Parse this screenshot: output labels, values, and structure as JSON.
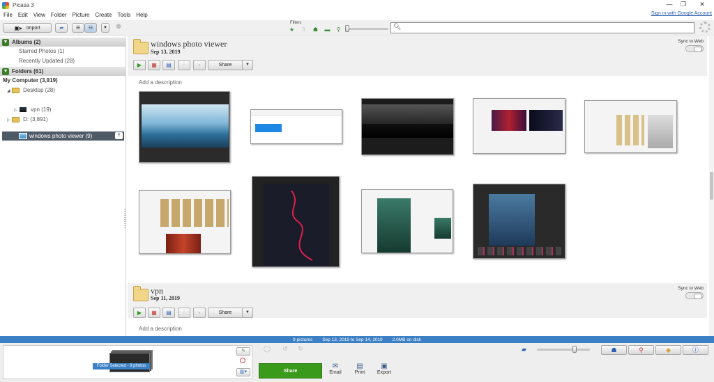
{
  "app": {
    "title": "Picasa 3",
    "signin": "Sign in with Google Account"
  },
  "menu": [
    "File",
    "Edit",
    "View",
    "Folder",
    "Picture",
    "Create",
    "Tools",
    "Help"
  ],
  "toolbar": {
    "import_label": "Import",
    "filters_label": "Filters",
    "search_value": ""
  },
  "sidebar": {
    "albums_header": "Albums (2)",
    "albums": [
      "Starred Photos (1)",
      "Recently Updated (28)"
    ],
    "folders_header": "Folders (61)",
    "tree": {
      "my_computer": "My Computer (3,919)",
      "desktop": "Desktop (28)",
      "selected": "windows photo viewer (9)",
      "vpn": "vpn (19)",
      "drive_d": "D: (3,891)"
    }
  },
  "sections": [
    {
      "title": "windows photo viewer",
      "date": "Sep 13, 2019",
      "sync_label": "Sync to Web",
      "share_label": "Share",
      "description": "Add a description"
    },
    {
      "title": "vpn",
      "date": "Sep 11, 2019",
      "sync_label": "Sync to Web",
      "share_label": "Share",
      "description": "Add a description"
    }
  ],
  "status": {
    "count": "9 pictures",
    "range": "Sep 13, 2019 to Sep 14, 2019",
    "disk": "2.0MB on disk"
  },
  "tray": {
    "selection_label": "Folder Selected - 9 photos",
    "share_label": "Share",
    "actions": [
      "Email",
      "Print",
      "Export"
    ]
  },
  "colors": {
    "status_bar": "#3b7fc4",
    "share_green": "#3a9a1c",
    "toggle_green": "#3a7d2a",
    "selection": "#4e5a66"
  }
}
